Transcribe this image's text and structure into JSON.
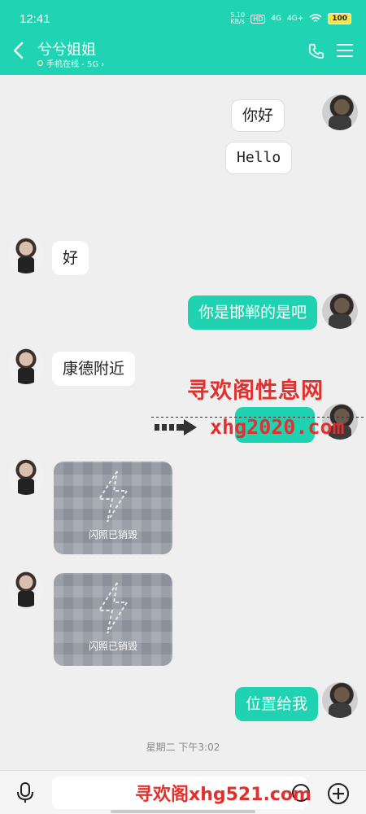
{
  "status_bar": {
    "time": "12:41",
    "speed_top": "5.10",
    "speed_bottom": "KB/s",
    "hd": "HD",
    "net1": "4G",
    "net2": "4G+",
    "battery": "100"
  },
  "header": {
    "title": "兮兮姐姐",
    "status": "手机在线 - 5G ›"
  },
  "messages": {
    "m1": "你好",
    "m2": "Hello",
    "m3": "好",
    "m4": "你是邯郸的是吧",
    "m5": "康德附近",
    "m6": "位置给我",
    "flash1_caption": "闪照已销毁",
    "flash2_caption": "闪照已销毁"
  },
  "timestamp": "星期二 下午3:02",
  "watermark": {
    "title": "寻欢阁性息网",
    "url": "xhg2020.com",
    "bottom": "寻欢阁xhg521.com"
  },
  "colors": {
    "accent": "#20d3b2",
    "watermark": "#e0312e"
  }
}
